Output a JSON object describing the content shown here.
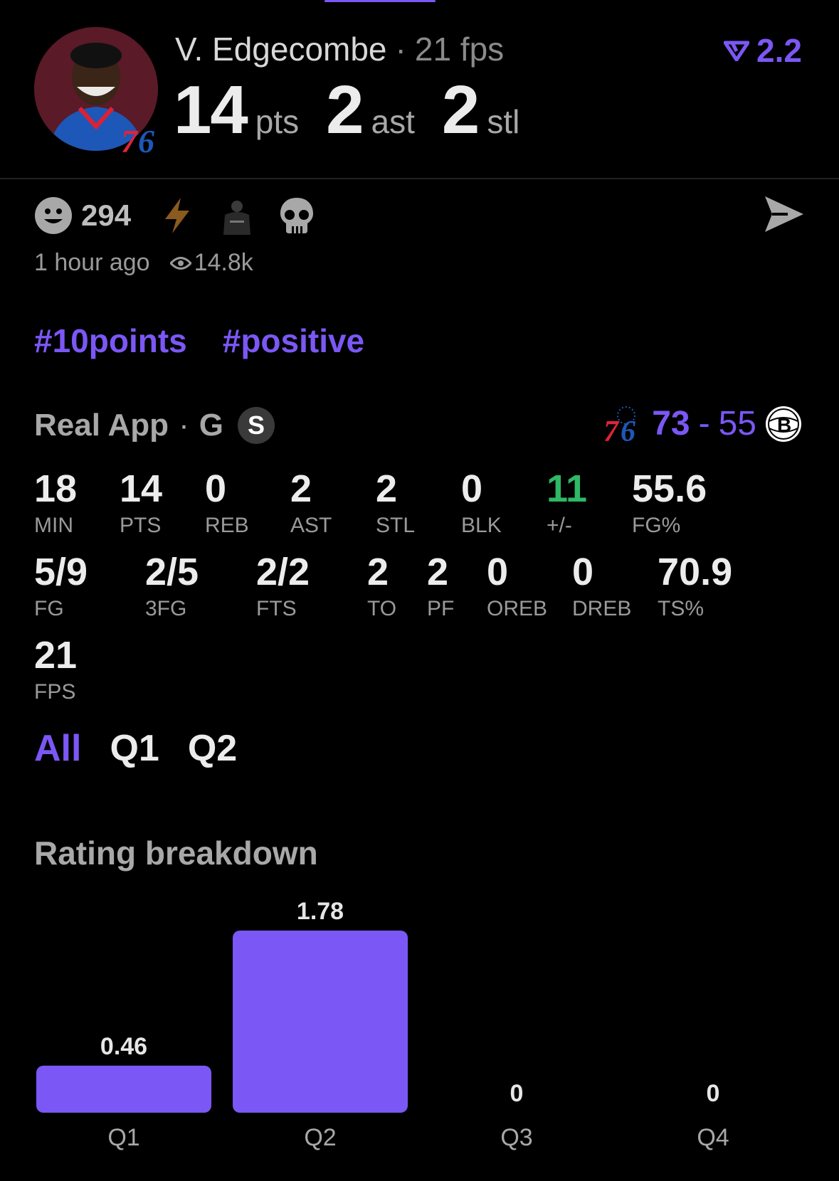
{
  "header": {
    "player_name": "V. Edgecombe",
    "separator": "·",
    "fps_text": "21 fps",
    "rating": "2.2",
    "headline_stats": [
      {
        "value": "14",
        "unit": "pts"
      },
      {
        "value": "2",
        "unit": "ast"
      },
      {
        "value": "2",
        "unit": "stl"
      }
    ],
    "team_badge": "76"
  },
  "reactions": {
    "count": "294",
    "icons": [
      "smiley-icon",
      "lightning-icon",
      "jersey-icon",
      "skull-icon",
      "send-icon"
    ],
    "time": "1 hour ago",
    "views": "14.8k"
  },
  "hashtags": [
    "#10points",
    "#positive"
  ],
  "game": {
    "source": "Real App",
    "separator": "·",
    "position": "G",
    "badge": "S",
    "home_score": "73",
    "dash": "-",
    "away_score": "55",
    "home_logo": "76",
    "away_logo": "B"
  },
  "stats_row1": [
    {
      "value": "18",
      "label": "MIN"
    },
    {
      "value": "14",
      "label": "PTS"
    },
    {
      "value": "0",
      "label": "REB"
    },
    {
      "value": "2",
      "label": "AST"
    },
    {
      "value": "2",
      "label": "STL"
    },
    {
      "value": "0",
      "label": "BLK"
    },
    {
      "value": "11",
      "label": "+/-"
    },
    {
      "value": "55.6",
      "label": "FG%"
    }
  ],
  "stats_row2": [
    {
      "value": "5/9",
      "label": "FG"
    },
    {
      "value": "2/5",
      "label": "3FG"
    },
    {
      "value": "2/2",
      "label": "FTS"
    },
    {
      "value": "2",
      "label": "TO"
    },
    {
      "value": "2",
      "label": "PF"
    },
    {
      "value": "0",
      "label": "OREB"
    },
    {
      "value": "0",
      "label": "DREB"
    },
    {
      "value": "70.9",
      "label": "TS%"
    }
  ],
  "stats_row3": [
    {
      "value": "21",
      "label": "FPS"
    }
  ],
  "periods": [
    "All",
    "Q1",
    "Q2"
  ],
  "breakdown_title": "Rating breakdown",
  "colors": {
    "accent": "#7b57f5",
    "positive": "#2fb865"
  },
  "chart_data": {
    "type": "bar",
    "title": "Rating breakdown",
    "categories": [
      "Q1",
      "Q2",
      "Q3",
      "Q4"
    ],
    "values": [
      0.46,
      1.78,
      0,
      0
    ],
    "value_labels": [
      "0.46",
      "1.78",
      "0",
      "0"
    ],
    "ylim": [
      0,
      1.78
    ],
    "grid": false
  }
}
